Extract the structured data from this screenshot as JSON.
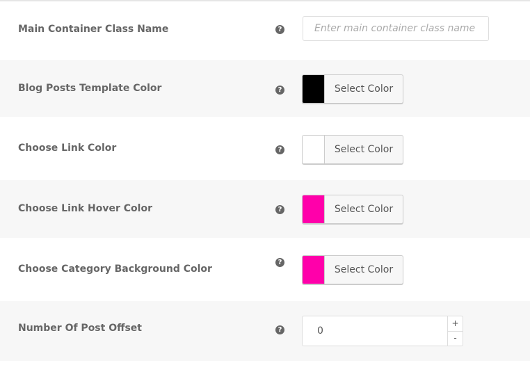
{
  "settings": {
    "container_class": {
      "label": "Main Container Class Name",
      "help_icon": "question-circle-icon",
      "input_value": "",
      "input_placeholder": "Enter main container class name"
    },
    "template_color": {
      "label": "Blog Posts Template Color",
      "help_icon": "question-circle-icon",
      "button_label": "Select Color",
      "swatch_color": "#000000"
    },
    "link_color": {
      "label": "Choose Link Color",
      "help_icon": "question-circle-icon",
      "button_label": "Select Color",
      "swatch_color": "#ffffff"
    },
    "link_hover_color": {
      "label": "Choose Link Hover Color",
      "help_icon": "question-circle-icon",
      "button_label": "Select Color",
      "swatch_color": "#ff00aa"
    },
    "category_bg_color": {
      "label": "Choose Category Background Color",
      "help_icon": "question-circle-icon",
      "button_label": "Select Color",
      "swatch_color": "#ff00aa"
    },
    "post_offset": {
      "label": "Number Of Post Offset",
      "help_icon": "question-circle-icon",
      "value": "0",
      "increment_symbol": "+",
      "decrement_symbol": "-"
    }
  },
  "help_glyph": "?",
  "colors": {
    "alt_row_background": "#f7f7f7",
    "label_text": "#666666",
    "border": "#dddddd"
  }
}
